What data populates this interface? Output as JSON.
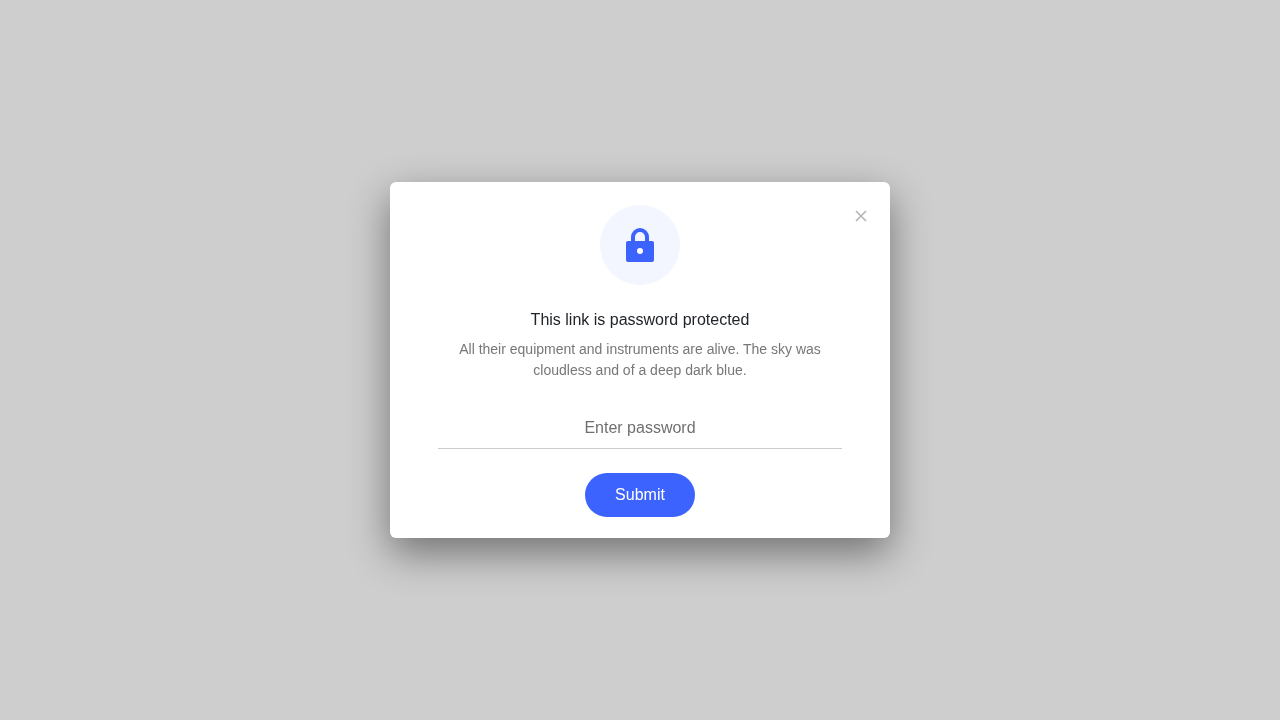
{
  "dialog": {
    "title": "This link is password protected",
    "message": "All their equipment and instruments are alive. The sky was cloudless and of a deep dark blue.",
    "password": {
      "placeholder": "Enter password"
    },
    "submit": "Submit"
  }
}
